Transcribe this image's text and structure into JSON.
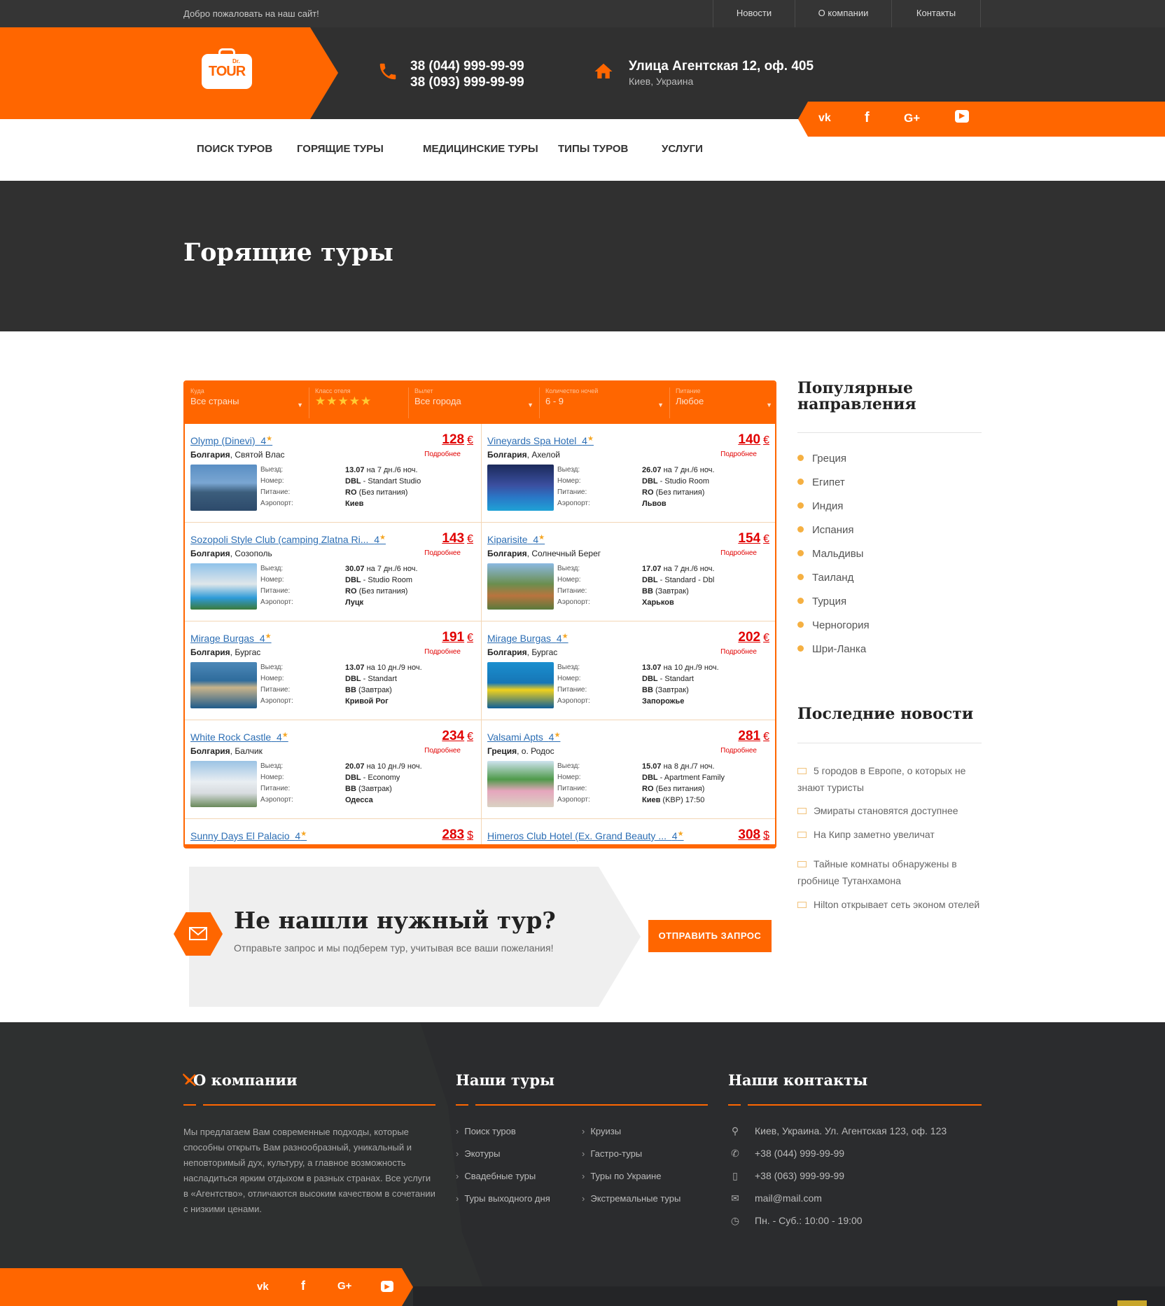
{
  "topbar": {
    "welcome": "Добро пожаловать на наш сайт!",
    "links": [
      "Новости",
      "О компании",
      "Контакты"
    ]
  },
  "header": {
    "logo_dr": "Dr.",
    "logo_tour": "TOUR",
    "phone1": "38 (044) 999-99-99",
    "phone2": "38 (093) 999-99-99",
    "address": "Улица Агентская 12, оф. 405",
    "city": "Киев, Украина"
  },
  "nav": {
    "items": [
      "ПОИСК ТУРОВ",
      "ГОРЯЩИЕ ТУРЫ",
      "МЕДИЦИНСКИЕ ТУРЫ",
      "ТИПЫ ТУРОВ",
      "УСЛУГИ"
    ]
  },
  "social": {
    "vk": "vk",
    "fb": "f",
    "gplus": "G+",
    "yt": "▶"
  },
  "page_title": "Горящие туры",
  "widget": {
    "filters": {
      "country_label": "Куда",
      "country_value": "Все страны",
      "stars_label": "Класс отеля",
      "stars_value": "★★★★★",
      "city_label": "Вылет",
      "city_value": "Все города",
      "nights_label": "Количество ночей",
      "nights_value": "6 - 9",
      "food_label": "Питание",
      "food_value": "Любое"
    },
    "field_labels": [
      "Выезд:",
      "Номер:",
      "Питание:",
      "Аэропорт:"
    ],
    "detail_link": "Подробнее",
    "cards": [
      {
        "name": "Olymp (Dinevi)",
        "stars": "4",
        "country": "Болгария",
        "place": "Святой Влас",
        "price": "128",
        "cur": "€",
        "date": "13.07",
        "nights": "на 7 дн./6 ноч.",
        "room_b": "DBL",
        "room": "- Standart Studio",
        "food_b": "RO",
        "food": "(Без питания)",
        "airport_b": "Киев",
        "airport": ""
      },
      {
        "name": "Vineyards Spa Hotel",
        "stars": "4",
        "country": "Болгария",
        "place": "Ахелой",
        "price": "140",
        "cur": "€",
        "date": "26.07",
        "nights": "на 7 дн./6 ноч.",
        "room_b": "DBL",
        "room": "- Studio Room",
        "food_b": "RO",
        "food": "(Без питания)",
        "airport_b": "Львов",
        "airport": ""
      },
      {
        "name": "Sozopoli Style Club (camping Zlatna Ri...",
        "stars": "4",
        "country": "Болгария",
        "place": "Созополь",
        "price": "143",
        "cur": "€",
        "date": "30.07",
        "nights": "на 7 дн./6 ноч.",
        "room_b": "DBL",
        "room": "- Studio Room",
        "food_b": "RO",
        "food": "(Без питания)",
        "airport_b": "Луцк",
        "airport": ""
      },
      {
        "name": "Kiparisite",
        "stars": "4",
        "country": "Болгария",
        "place": "Солнечный Берег",
        "price": "154",
        "cur": "€",
        "date": "17.07",
        "nights": "на 7 дн./6 ноч.",
        "room_b": "DBL",
        "room": "- Standard - Dbl",
        "food_b": "BB",
        "food": "(Завтрак)",
        "airport_b": "Харьков",
        "airport": ""
      },
      {
        "name": "Mirage Burgas",
        "stars": "4",
        "country": "Болгария",
        "place": "Бургас",
        "price": "191",
        "cur": "€",
        "date": "13.07",
        "nights": "на 10 дн./9 ноч.",
        "room_b": "DBL",
        "room": "- Standart",
        "food_b": "BB",
        "food": "(Завтрак)",
        "airport_b": "Кривой Рог",
        "airport": ""
      },
      {
        "name": "Mirage Burgas",
        "stars": "4",
        "country": "Болгария",
        "place": "Бургас",
        "price": "202",
        "cur": "€",
        "date": "13.07",
        "nights": "на 10 дн./9 ноч.",
        "room_b": "DBL",
        "room": "- Standart",
        "food_b": "BB",
        "food": "(Завтрак)",
        "airport_b": "Запорожье",
        "airport": ""
      },
      {
        "name": "White Rock Castle",
        "stars": "4",
        "country": "Болгария",
        "place": "Балчик",
        "price": "234",
        "cur": "€",
        "date": "20.07",
        "nights": "на 10 дн./9 ноч.",
        "room_b": "DBL",
        "room": "- Economy",
        "food_b": "BB",
        "food": "(Завтрак)",
        "airport_b": "Одесса",
        "airport": ""
      },
      {
        "name": "Valsami Apts",
        "stars": "4",
        "country": "Греция",
        "place": "о. Родос",
        "price": "281",
        "cur": "€",
        "date": "15.07",
        "nights": "на 8 дн./7 ноч.",
        "room_b": "DBL",
        "room": "- Apartment Family",
        "food_b": "RO",
        "food": "(Без питания)",
        "airport_b": "Киев",
        "airport": "(KBP) 17:50"
      },
      {
        "name": "Sunny Days El Palacio",
        "stars": "4",
        "country": "",
        "place": "",
        "price": "283",
        "cur": "$"
      },
      {
        "name": "Himeros Club Hotel (Ex. Grand Beauty ...",
        "stars": "4",
        "country": "",
        "place": "",
        "price": "308",
        "cur": "$"
      }
    ]
  },
  "cta": {
    "title": "Не нашли нужный тур?",
    "subtitle": "Отправьте запрос и мы подберем тур, учитывая все ваши пожелания!",
    "button": "ОТПРАВИТЬ ЗАПРОС"
  },
  "sidebar": {
    "popular_title_1": "Популярные",
    "popular_title_2": "направления",
    "destinations": [
      "Греция",
      "Египет",
      "Индия",
      "Испания",
      "Мальдивы",
      "Таиланд",
      "Турция",
      "Черногория",
      "Шри-Ланка"
    ],
    "news_title": "Последние новости",
    "news": [
      "5 городов в Европе, о которых не знают туристы",
      "Эмираты становятся доступнее",
      "На Кипр заметно увеличат",
      "Тайные комнаты обнаружены в гробнице Тутанхамона",
      "Hilton открывает сеть эконом отелей"
    ]
  },
  "footer": {
    "about_title": "О компании",
    "about_text": "Мы предлагаем Вам современные подходы, которые способны открыть Вам разнообразный, уникальный и неповторимый дух, культуру, а главное возможность насладиться ярким отдыхом в разных странах. Все услуги в «Агентство», отличаются высоким качеством в сочетании с низкими ценами.",
    "tours_title": "Наши туры",
    "tours_col1": [
      "Поиск туров",
      "Экотуры",
      "Свадебные туры",
      "Туры выходного дня"
    ],
    "tours_col2": [
      "Круизы",
      "Гастро-туры",
      "Туры по Украине",
      "Экстремальные туры"
    ],
    "contacts_title": "Наши контакты",
    "contacts": [
      "Киев, Украина. Ул. Агентская 123, оф. 123",
      "+38 (044) 999-99-99",
      "+38 (063) 999-99-99",
      "mail@mail.com",
      "Пн. - Суб.: 10:00 - 19:00"
    ]
  },
  "colors": {
    "accent": "#ff6600",
    "dark": "#303030",
    "price": "#e10000",
    "link": "#2c6eb4"
  }
}
